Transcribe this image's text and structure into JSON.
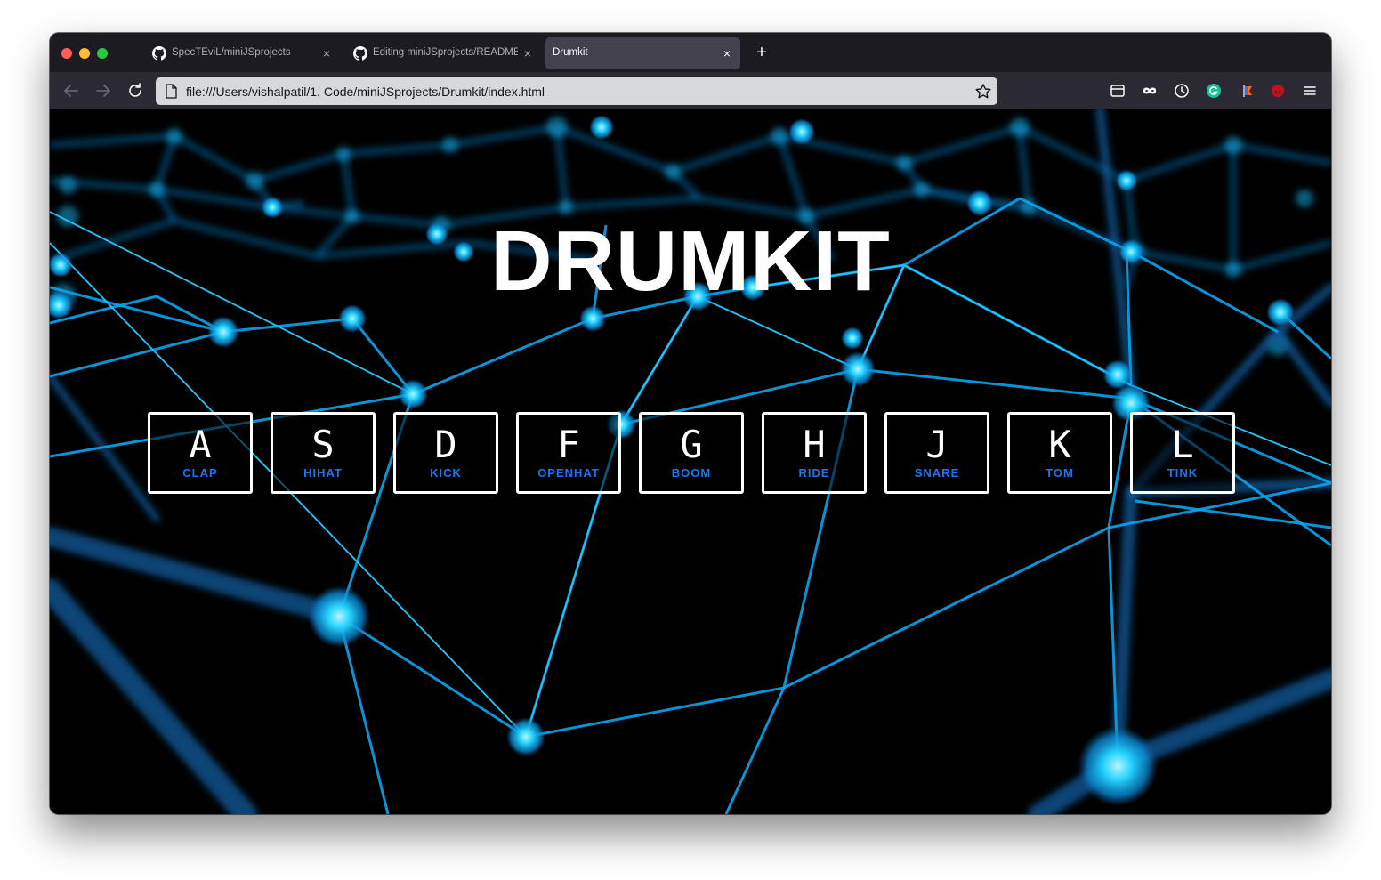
{
  "browser": {
    "tabs": [
      {
        "title": "SpecTEviL/miniJSprojects",
        "icon": "github-icon",
        "active": false
      },
      {
        "title": "Editing miniJSprojects/README.md",
        "icon": "github-icon",
        "active": false
      },
      {
        "title": "Drumkit",
        "icon": "",
        "active": true
      }
    ],
    "new_tab_label": "+",
    "close_label": "×",
    "url": "file:///Users/vishalpatil/1. Code/miniJSprojects/Drumkit/index.html"
  },
  "colors": {
    "accent_blue": "#1a76f2",
    "network_glow": "#00c8ff"
  },
  "page": {
    "title": "DRUMKIT",
    "keys": [
      {
        "key": "A",
        "sound": "CLAP"
      },
      {
        "key": "S",
        "sound": "HIHAT"
      },
      {
        "key": "D",
        "sound": "KICK"
      },
      {
        "key": "F",
        "sound": "OPENHAT"
      },
      {
        "key": "G",
        "sound": "BOOM"
      },
      {
        "key": "H",
        "sound": "RIDE"
      },
      {
        "key": "J",
        "sound": "SNARE"
      },
      {
        "key": "K",
        "sound": "TOM"
      },
      {
        "key": "L",
        "sound": "TINK"
      }
    ]
  }
}
